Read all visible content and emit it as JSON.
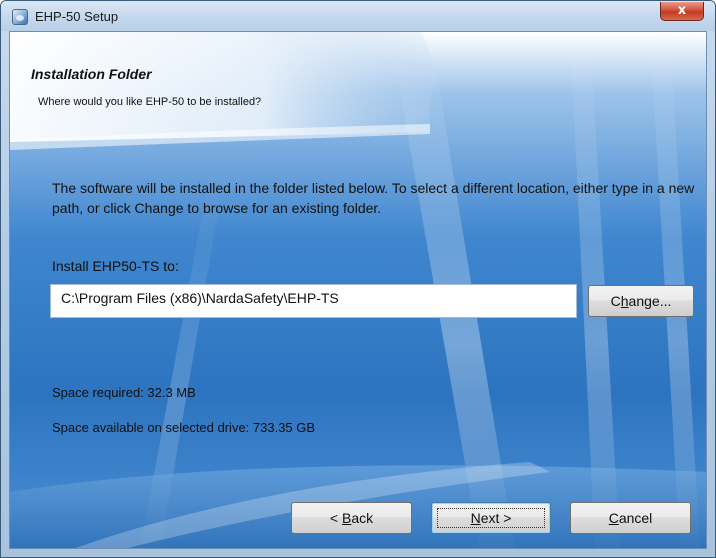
{
  "window": {
    "title": "EHP-50 Setup",
    "close_symbol": "x"
  },
  "header": {
    "title": "Installation Folder",
    "subtitle": "Where would you like EHP-50  to be installed?"
  },
  "body": {
    "description": "The software will be installed in the folder listed below. To select a different location, either type in a new path, or click Change to browse for an existing folder.",
    "install_label": "Install EHP50-TS to:",
    "install_path": "C:\\Program Files (x86)\\NardaSafety\\EHP-TS",
    "space_required": "Space required: 32.3 MB",
    "space_available": "Space available on selected drive: 733.35 GB"
  },
  "buttons": {
    "change": {
      "prefix": "C",
      "mnemonic": "h",
      "suffix": "ange..."
    },
    "back": {
      "prefix": "< ",
      "mnemonic": "B",
      "suffix": "ack"
    },
    "next": {
      "prefix": "",
      "mnemonic": "N",
      "suffix": "ext >"
    },
    "cancel": {
      "prefix": "",
      "mnemonic": "C",
      "suffix": "ancel"
    }
  },
  "colors": {
    "accent": "#2d74c0",
    "titlebar": "#c6d9ee",
    "close": "#c13b22"
  },
  "icons": {
    "app": "setup-icon",
    "close": "close-icon"
  }
}
